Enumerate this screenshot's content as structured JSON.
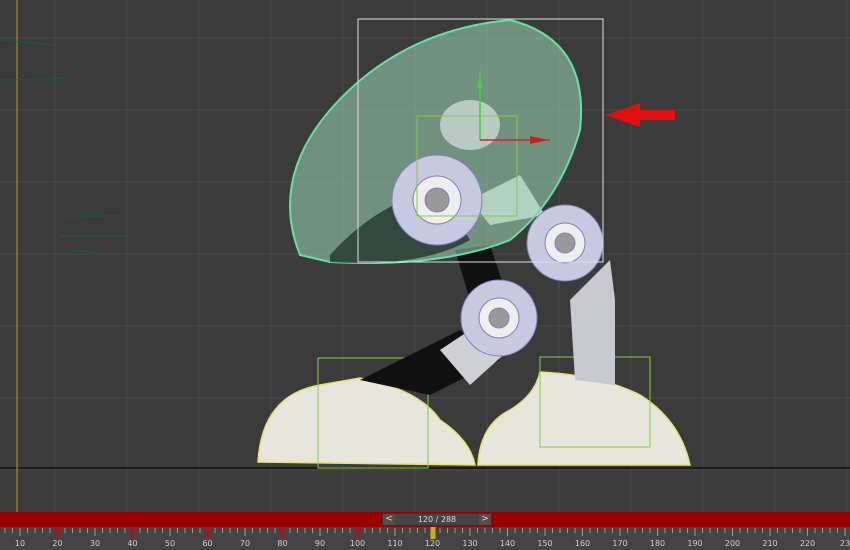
{
  "viewport": {
    "background": "#3b3b3b",
    "selection_color": "#66e0a0",
    "move_gizmo_arrow_color": "#e01010"
  },
  "time_slider": {
    "current_frame": 120,
    "total_frames": 288,
    "readout": "120 / 288",
    "prev_label": "<",
    "next_label": ">"
  },
  "track_bar": {
    "tick_labels": [
      "10",
      "20",
      "30",
      "40",
      "50",
      "60",
      "70",
      "80",
      "90",
      "100",
      "110",
      "120",
      "130",
      "140",
      "150",
      "160",
      "170",
      "180",
      "190",
      "200",
      "210",
      "220",
      "23"
    ],
    "keyframes": [
      20,
      40,
      60,
      80,
      100
    ],
    "current_frame": 120,
    "key_color": "#a01818",
    "current_color": "#c8b020"
  }
}
